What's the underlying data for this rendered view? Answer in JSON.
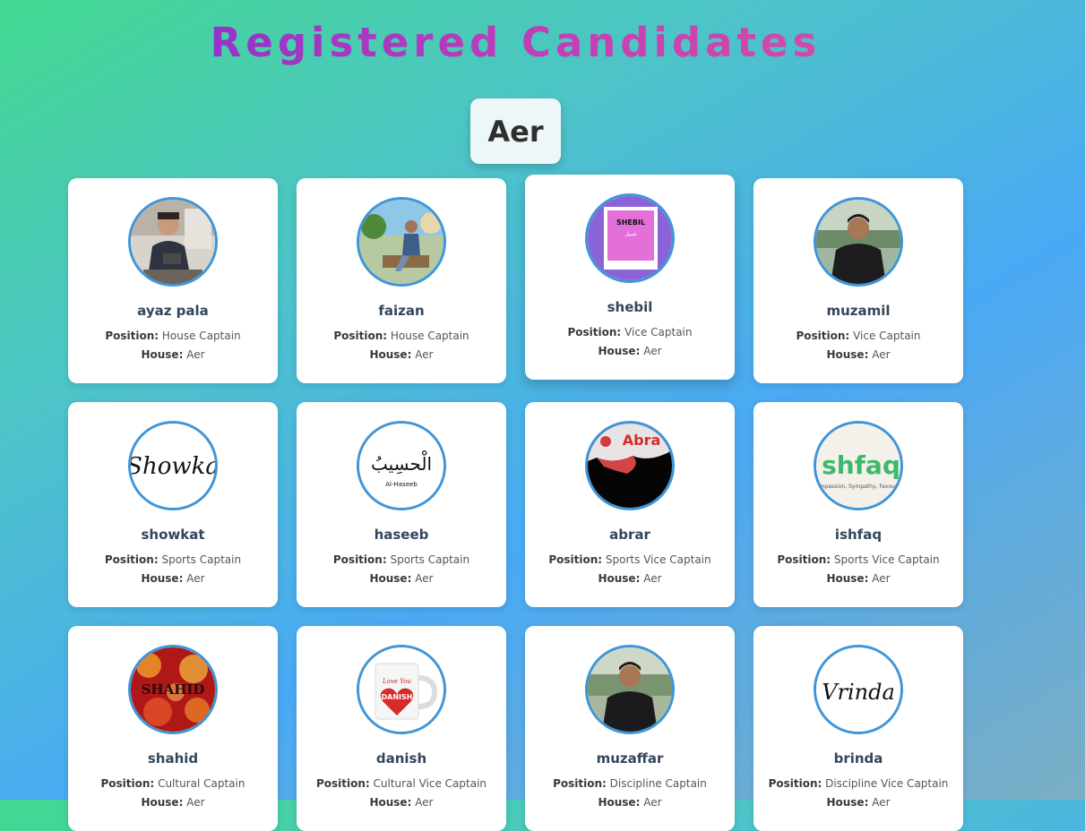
{
  "page": {
    "title": "Registered Candidates"
  },
  "house": {
    "name": "Aer"
  },
  "labels": {
    "position": "Position:",
    "house": "House:"
  },
  "candidates": [
    {
      "name": "ayaz pala",
      "position": "House Captain",
      "house": "Aer",
      "avatar_icon": "person-photo"
    },
    {
      "name": "faizan",
      "position": "House Captain",
      "house": "Aer",
      "avatar_icon": "person-photo"
    },
    {
      "name": "shebil",
      "position": "Vice Captain",
      "house": "Aer",
      "avatar_icon": "book-cover",
      "avatar_text": "SHEBIL"
    },
    {
      "name": "muzamil",
      "position": "Vice Captain",
      "house": "Aer",
      "avatar_icon": "person-photo"
    },
    {
      "name": "showkat",
      "position": "Sports Captain",
      "house": "Aer",
      "avatar_icon": "signature",
      "avatar_text": "Showka"
    },
    {
      "name": "haseeb",
      "position": "Sports Captain",
      "house": "Aer",
      "avatar_icon": "calligraphy",
      "avatar_text": "الْحسِيبُ",
      "avatar_subtext": "Al-Haseeb"
    },
    {
      "name": "abrar",
      "position": "Sports Vice Captain",
      "house": "Aer",
      "avatar_icon": "name-art",
      "avatar_text": "Abra"
    },
    {
      "name": "ishfaq",
      "position": "Sports Vice Captain",
      "house": "Aer",
      "avatar_icon": "name-art",
      "avatar_text": "shfaq",
      "avatar_subtext": "mpassion, Sympathy, Favour"
    },
    {
      "name": "shahid",
      "position": "Cultural Captain",
      "house": "Aer",
      "avatar_icon": "name-art",
      "avatar_text": "SHAHID"
    },
    {
      "name": "danish",
      "position": "Cultural Vice Captain",
      "house": "Aer",
      "avatar_icon": "mug-art",
      "avatar_text": "DANISH",
      "avatar_subtext": "Love You"
    },
    {
      "name": "muzaffar",
      "position": "Discipline Captain",
      "house": "Aer",
      "avatar_icon": "person-photo"
    },
    {
      "name": "brinda",
      "position": "Discipline Vice Captain",
      "house": "Aer",
      "avatar_icon": "signature",
      "avatar_text": "Vrinda"
    }
  ]
}
